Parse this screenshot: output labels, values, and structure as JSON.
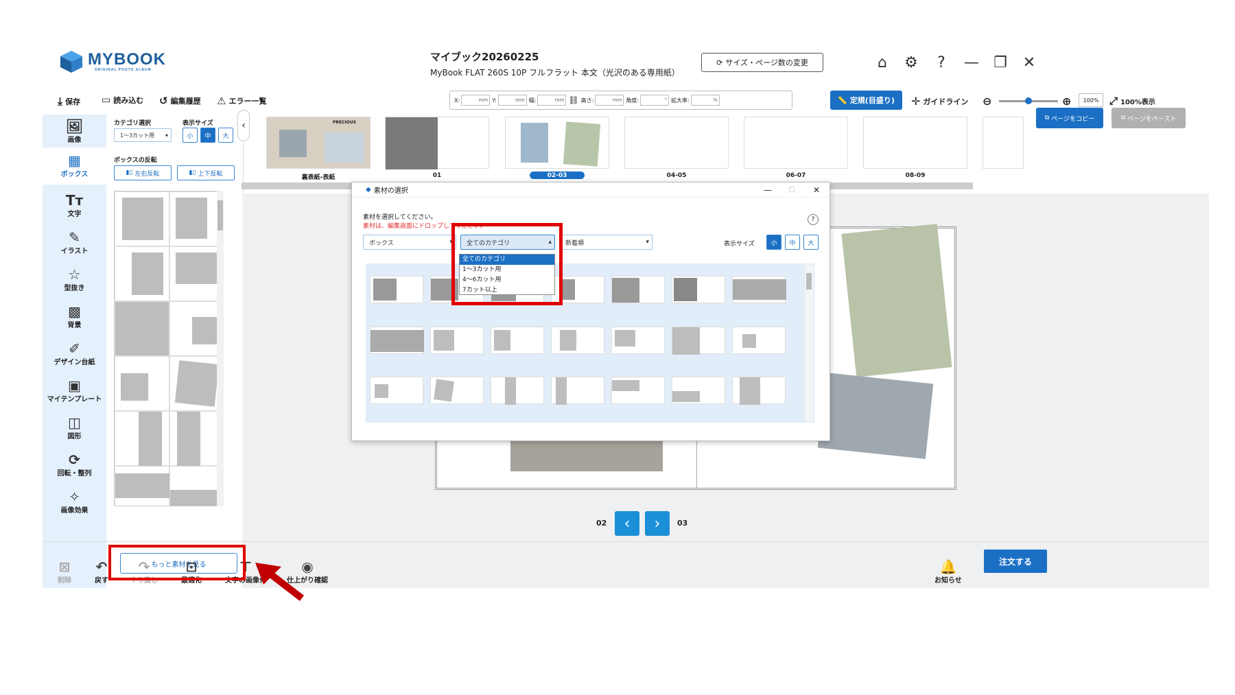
{
  "app": {
    "logo_name": "MYBOOK",
    "logo_sub": "ORIGINAL PHOTO ALBUM",
    "brand_color": "#1b6fc4",
    "highlight_color": "#e00000"
  },
  "header": {
    "doc_title": "マイブック20260225",
    "doc_subtitle": "MyBook FLAT 260S 10P フルフラット 本文（光沢のある専用紙）",
    "size_button": "サイズ・ページ数の変更"
  },
  "toolbar": {
    "save": "保存",
    "load": "読み込む",
    "history": "編集履歴",
    "errors": "エラー一覧",
    "coords": [
      {
        "label": "X:",
        "unit": "mm"
      },
      {
        "label": "Y:",
        "unit": "mm"
      },
      {
        "label": "幅:",
        "unit": "mm"
      },
      {
        "label": "高さ:",
        "unit": "mm"
      },
      {
        "label": "角度:",
        "unit": "°"
      },
      {
        "label": "拡大率:",
        "unit": "%"
      }
    ],
    "ruler": "定規(目盛り)",
    "guideline": "ガイドライン",
    "zoom_value": "100%",
    "fit": "100%表示"
  },
  "nav": [
    {
      "label": "画像",
      "icon": "image-icon"
    },
    {
      "label": "ボックス",
      "icon": "box-layout-icon"
    },
    {
      "label": "文字",
      "icon": "text-icon"
    },
    {
      "label": "イラスト",
      "icon": "brush-icon"
    },
    {
      "label": "型抜き",
      "icon": "star-cutout-icon"
    },
    {
      "label": "背景",
      "icon": "checker-icon"
    },
    {
      "label": "デザイン台紙",
      "icon": "design-mount-icon"
    },
    {
      "label": "マイテンプレート",
      "icon": "template-icon"
    },
    {
      "label": "図形",
      "icon": "shape-icon"
    },
    {
      "label": "回転・整列",
      "icon": "rotate-icon"
    },
    {
      "label": "画像効果",
      "icon": "magic-wand-icon"
    }
  ],
  "panel": {
    "category_label": "カテゴリ選択",
    "category_value": "1〜3カット用",
    "size_label": "表示サイズ",
    "size_small": "小",
    "size_mid": "中",
    "size_large": "大",
    "flip_label": "ボックスの反転",
    "flip_lr": "左右反転",
    "flip_ud": "上下反転",
    "more_button": "もっと素材を見る"
  },
  "pages": {
    "thumbs": [
      "裏表紙-表紙",
      "01",
      "02-03",
      "04-05",
      "06-07",
      "08-09"
    ],
    "copy": "ページをコピー",
    "paste": "ページをペースト",
    "cover_text": "PRECIOUS"
  },
  "dialog": {
    "title": "素材の選択",
    "instruction": "素材を選択してください。",
    "note": "素材は、編集画面にドロップしてください。",
    "type_value": "ボックス",
    "category_value": "全てのカテゴリ",
    "sort_value": "新着順",
    "size_label": "表示サイズ",
    "size_small": "小",
    "size_mid": "中",
    "size_large": "大",
    "options": [
      "全てのカテゴリ",
      "1〜3カット用",
      "4〜6カット用",
      "7カット以上"
    ]
  },
  "pager": {
    "left": "02",
    "right": "03"
  },
  "bottom": {
    "delete": "削除",
    "undo": "戻す",
    "redo": "やり直し",
    "optimize": "最適化",
    "text_image": "文字の画像化",
    "preview": "仕上がり確認",
    "notice": "お知らせ",
    "order": "注文する"
  }
}
